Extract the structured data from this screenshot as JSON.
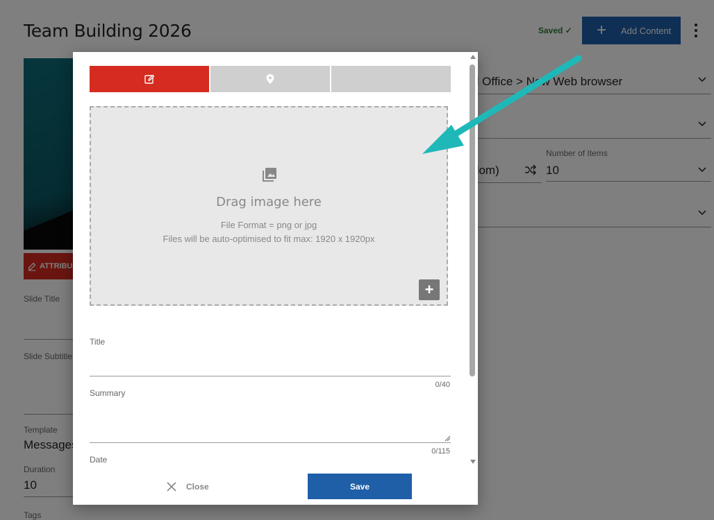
{
  "page": {
    "title": "Team Building 2026",
    "saved_text": "Saved ✓",
    "add_content_label": "Add Content",
    "attrib_label": "ATTRIBU",
    "labels": {
      "slide_title": "Slide Title",
      "slide_subtitle": "Slide Subtitle",
      "template": "Template",
      "duration": "Duration",
      "tags": "Tags"
    },
    "values": {
      "template": "Messages",
      "duration": "10"
    },
    "right": {
      "source_value": "d Office > New Web browser",
      "order_value": "dom)",
      "number_of_items_label": "Number of Items",
      "number_of_items_value": "10"
    }
  },
  "modal": {
    "tabs": [
      {
        "icon": "edit-icon",
        "active": true
      },
      {
        "icon": "location-pin-icon",
        "active": false
      },
      {
        "icon": "",
        "active": false
      }
    ],
    "dropzone": {
      "title": "Drag image here",
      "format": "File Format = png or jpg",
      "optimise": "Files will be auto-optimised to fit max: 1920 x 1920px"
    },
    "fields": {
      "title_label": "Title",
      "title_counter": "0/40",
      "summary_label": "Summary",
      "summary_counter": "0/115",
      "date_label": "Date"
    },
    "buttons": {
      "close_label": "Close",
      "save_label": "Save"
    }
  },
  "colors": {
    "accent_red": "#d62b20",
    "primary_blue": "#1f5fa8",
    "arrow_teal": "#1fb8b8",
    "saved_green": "#2e7d32"
  }
}
